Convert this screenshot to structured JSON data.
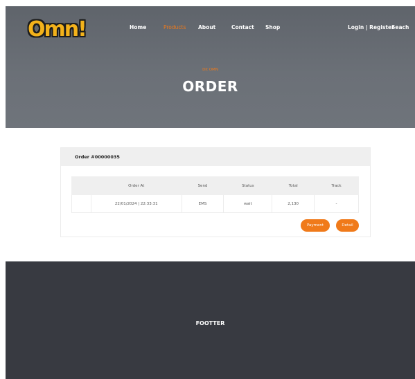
{
  "header": {
    "logo_text": "Omn!",
    "nav": {
      "home": "Home",
      "products": "Products",
      "about": "About",
      "contact": "Contact",
      "shop": "Shop",
      "login_register": "Login | Register",
      "search": "Seach"
    },
    "accent_color": "#f07a1a"
  },
  "hero": {
    "breadcrumb": "Dit OMN",
    "title": "ORDER"
  },
  "order": {
    "title": "Order #00000035",
    "columns": [
      "",
      "Order At",
      "Send",
      "Status",
      "Total",
      "Track"
    ],
    "rows": [
      [
        "",
        "22/01/2024 | 22:33:31",
        "EMS",
        "wait",
        "2,130",
        "-"
      ]
    ],
    "payment_label": "Payment",
    "detail_label": "Detail"
  },
  "footer": {
    "text": "FOOTTER"
  }
}
